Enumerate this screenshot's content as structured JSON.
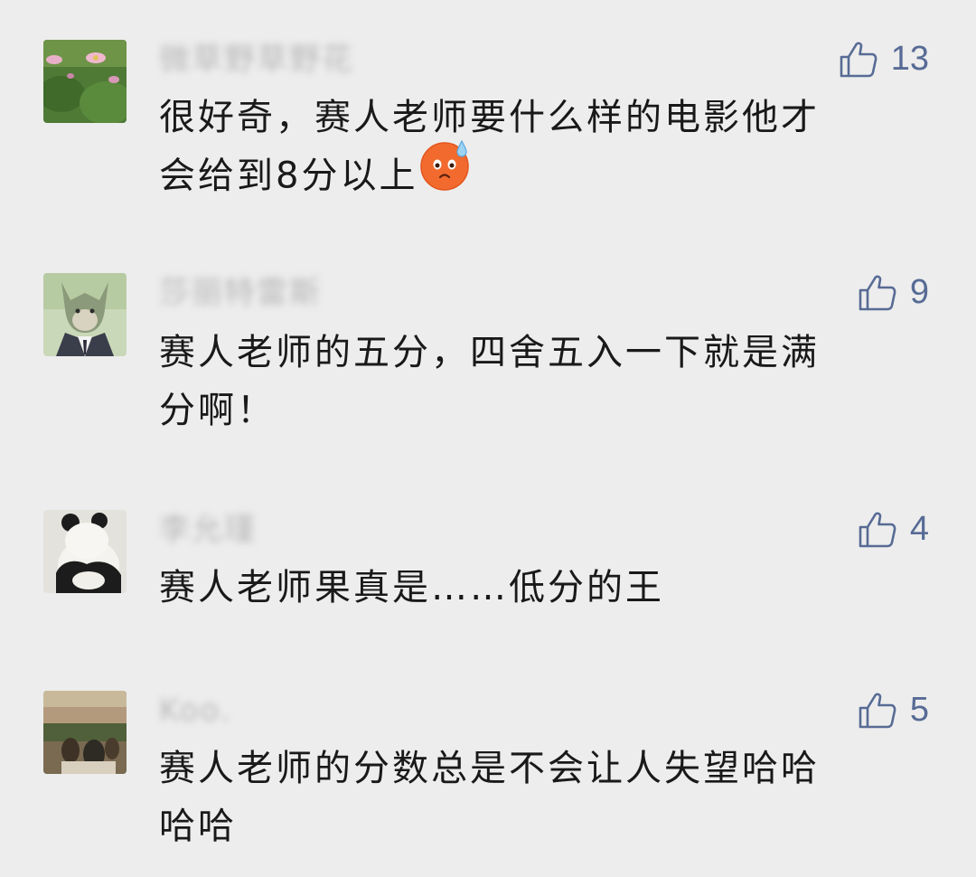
{
  "comments": [
    {
      "username": "微草野草野花",
      "likes": "13",
      "text_lines": [
        "很好奇，赛人老师要什么样的电影他才",
        "会给到8分以上"
      ],
      "emoji": "anxious-sweat-face-emoji",
      "avatar": "flower-photo-avatar"
    },
    {
      "username": "莎丽特雷斯",
      "likes": "9",
      "text_lines": [
        "赛人老师的五分，四舍五入一下就是满",
        "分啊！"
      ],
      "avatar": "wolf-character-avatar"
    },
    {
      "username": "李允瑾",
      "likes": "4",
      "text_lines": [
        "赛人老师果真是……低分的王"
      ],
      "avatar": "panda-avatar"
    },
    {
      "username": "Koo.",
      "likes": "5",
      "text_lines": [
        "赛人老师的分数总是不会让人失望哈哈",
        "哈哈"
      ],
      "avatar": "landscape-photo-avatar"
    }
  ],
  "colors": {
    "background": "#ededed",
    "like_accent": "#576b95",
    "text": "#191919",
    "username_blurred": "#b8b8b8"
  },
  "icons": [
    "thumbs-up-icon"
  ]
}
